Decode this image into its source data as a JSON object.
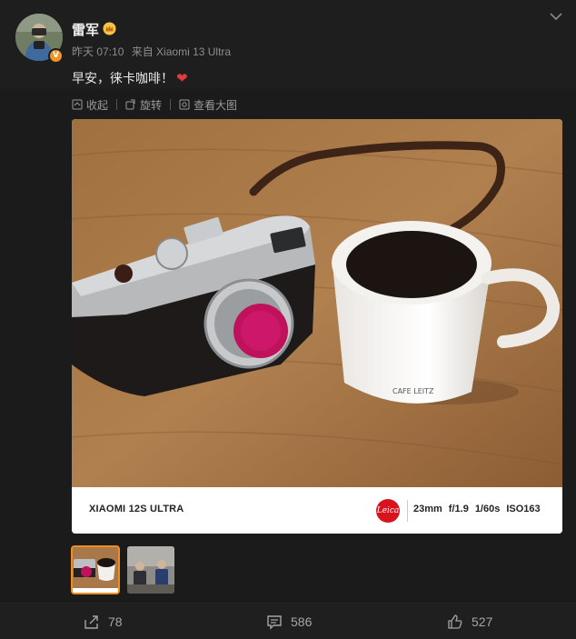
{
  "post": {
    "username": "雷军",
    "time": "昨天 07:10",
    "source": "来自 Xiaomi 13 Ultra",
    "text": "早安，徕卡咖啡！",
    "heart": "❤",
    "verified_badge": "V"
  },
  "toolbar": {
    "collapse": "收起",
    "rotate": "旋转",
    "view_large": "查看大图"
  },
  "watermark": {
    "brand": "XIAOMI 12S ULTRA",
    "logo": "Leica",
    "focal": "23mm",
    "aperture": "f/1.9",
    "shutter": "1/60s",
    "iso": "ISO163"
  },
  "footer": {
    "shares": "78",
    "comments": "586",
    "likes": "527"
  },
  "colors": {
    "accent": "#f28c1c",
    "heart": "#e33b3b",
    "leica_red": "#d7131d"
  },
  "icons": [
    "chevron-down-icon",
    "crown-icon",
    "collapse-icon",
    "rotate-icon",
    "zoom-icon",
    "share-icon",
    "comment-icon",
    "like-icon"
  ]
}
